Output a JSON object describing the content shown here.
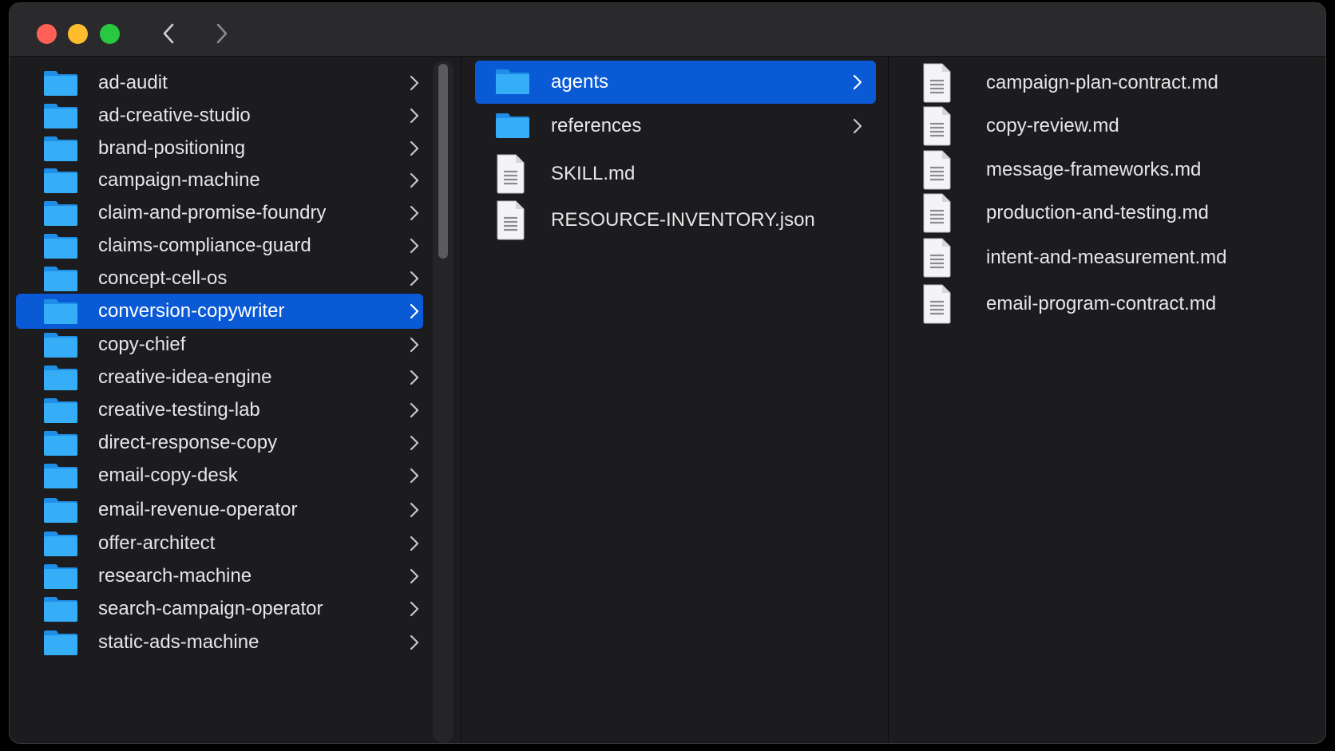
{
  "window": {
    "nav": {
      "back_icon": "chevron-left-icon",
      "forward_icon": "chevron-right-icon"
    }
  },
  "colors": {
    "selection": "#0a5ad6",
    "folder": "#2ba3f5",
    "window_bg": "#1c1c1e"
  },
  "column1": {
    "items": [
      {
        "label": "ad-audit"
      },
      {
        "label": "ad-creative-studio"
      },
      {
        "label": "brand-positioning"
      },
      {
        "label": "campaign-machine"
      },
      {
        "label": "claim-and-promise-foundry"
      },
      {
        "label": "claims-compliance-guard"
      },
      {
        "label": "concept-cell-os"
      },
      {
        "label": "conversion-copywriter"
      },
      {
        "label": "copy-chief"
      },
      {
        "label": "creative-idea-engine"
      },
      {
        "label": "creative-testing-lab"
      },
      {
        "label": "direct-response-copy"
      },
      {
        "label": "email-copy-desk"
      },
      {
        "label": "email-revenue-operator"
      },
      {
        "label": "offer-architect"
      },
      {
        "label": "research-machine"
      },
      {
        "label": "search-campaign-operator"
      },
      {
        "label": "static-ads-machine"
      }
    ],
    "selected": "conversion-copywriter"
  },
  "column2": {
    "items": [
      {
        "label": "agents",
        "kind": "folder"
      },
      {
        "label": "references",
        "kind": "folder"
      },
      {
        "label": "SKILL.md",
        "kind": "file"
      },
      {
        "label": "RESOURCE-INVENTORY.json",
        "kind": "file"
      }
    ],
    "selected": "agents"
  },
  "column3": {
    "items": [
      {
        "label": "campaign-plan-contract.md"
      },
      {
        "label": "copy-review.md"
      },
      {
        "label": "message-frameworks.md"
      },
      {
        "label": "production-and-testing.md"
      },
      {
        "label": "intent-and-measurement.md"
      },
      {
        "label": "email-program-contract.md"
      }
    ]
  }
}
